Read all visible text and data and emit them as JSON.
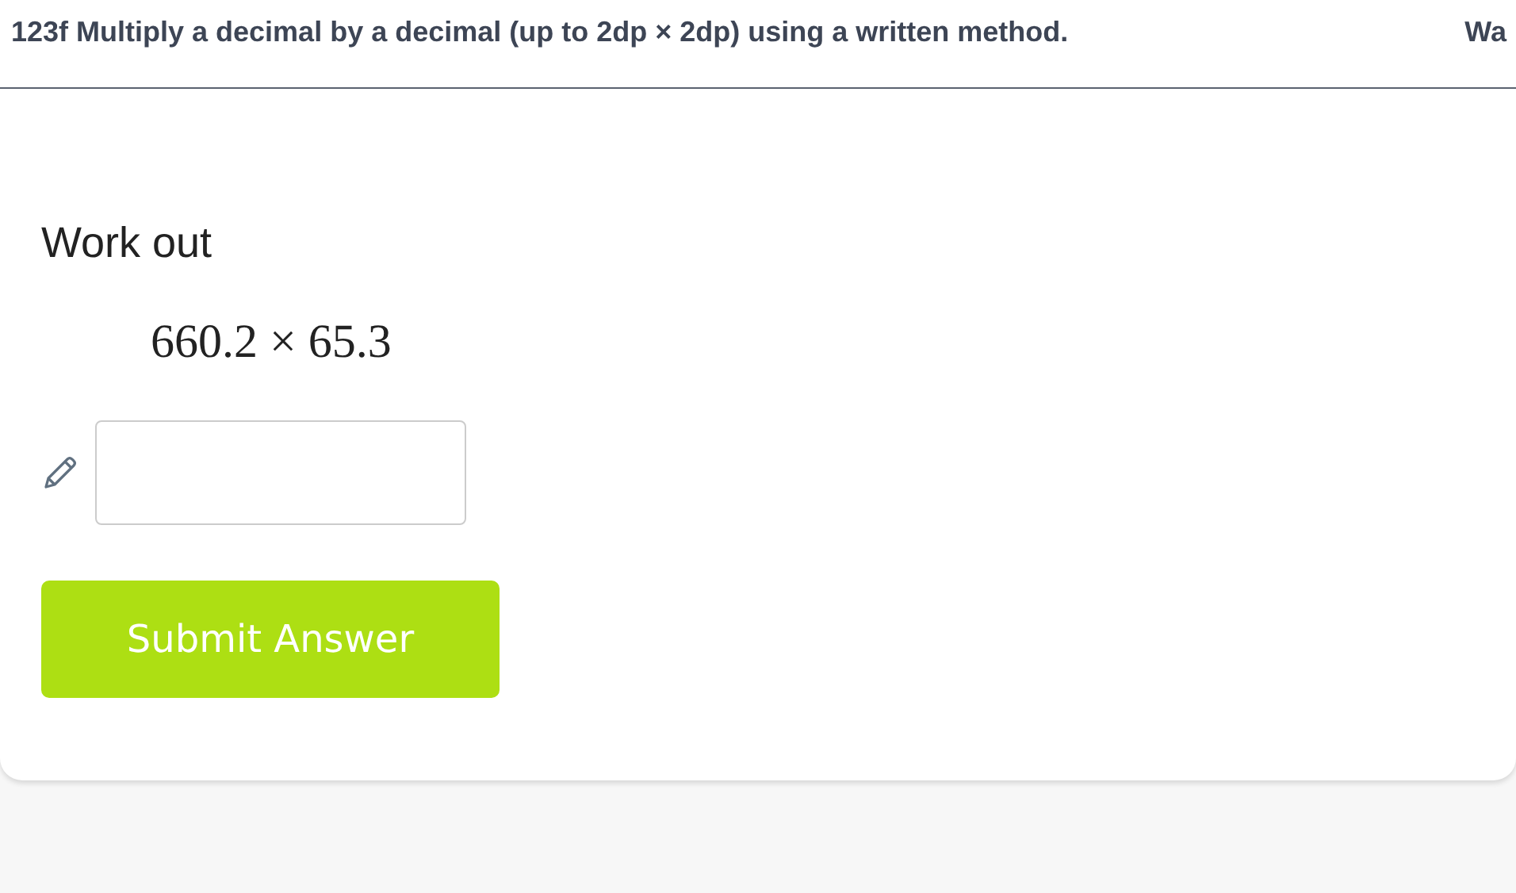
{
  "header": {
    "title": "123f Multiply a decimal by a decimal (up to 2dp × 2dp) using a written method.",
    "side_text": "Wa"
  },
  "question": {
    "prompt": "Work out",
    "expression": "660.2 × 65.3"
  },
  "submit_button": "Submit Answer"
}
